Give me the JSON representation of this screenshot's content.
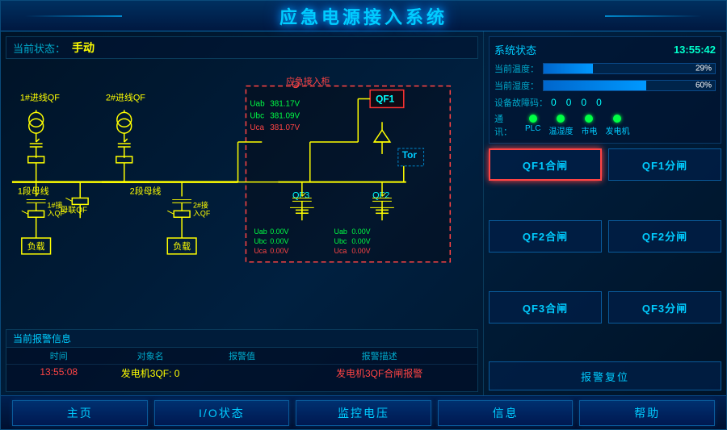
{
  "title": "应急电源接入系统",
  "header": {
    "title": "应急电源接入系统"
  },
  "status": {
    "label": "当前状态：",
    "value": "手动"
  },
  "system_status": {
    "title": "系统状态",
    "time": "13:55:42",
    "temp_label": "当前温度：",
    "temp_percent": "29%",
    "temp_width": "29",
    "humidity_label": "当前湿度：",
    "humidity_percent": "60%",
    "humidity_width": "60",
    "fault_label": "设备故障码：",
    "fault_values": [
      "0",
      "0",
      "0",
      "0"
    ],
    "comm_label": "通  讯：",
    "comm_items": [
      {
        "name": "PLC",
        "active": true
      },
      {
        "name": "温湿度",
        "active": true
      },
      {
        "name": "市电",
        "active": true
      },
      {
        "name": "发电机",
        "active": true
      }
    ]
  },
  "emergency_box": {
    "label": "应急接入柜",
    "qf1_label": "QF1",
    "uab1": "381.17V",
    "ubc1": "381.09V",
    "uca1": "381.07V",
    "uab2": "0.00V",
    "ubc2": "0.00V",
    "uca2": "0.00V",
    "uab3": "0.00V",
    "ubc3": "0.00V",
    "uca3": "0.00V"
  },
  "diagram": {
    "feeder1": "1#进线QF",
    "feeder2": "2#进线QF",
    "bus1": "1段母线",
    "bus2": "2段母线",
    "tie": "母联QF",
    "incoming1": "1#接\n入QF",
    "incoming2": "2#接\n入QF",
    "load1": "负载",
    "load2": "负载",
    "qf3": "QF3",
    "qf2": "QF2",
    "tor": "Tor"
  },
  "buttons": {
    "qf1_close": "QF1合闸",
    "qf1_open": "QF1分闸",
    "qf2_close": "QF2合闸",
    "qf2_open": "QF2分闸",
    "qf3_close": "QF3合闸",
    "qf3_open": "QF3分闸",
    "reset": "报警复位"
  },
  "alerts": {
    "title": "当前报警信息",
    "columns": [
      "时间",
      "对象名",
      "报警值",
      "报警描述"
    ],
    "rows": [
      {
        "time": "13:55:08",
        "obj": "发电机3QF: 0",
        "val": "",
        "desc": "发电机3QF合闸报警"
      }
    ]
  },
  "nav": {
    "items": [
      "主页",
      "I/O状态",
      "监控电压",
      "信息",
      "帮助"
    ]
  }
}
